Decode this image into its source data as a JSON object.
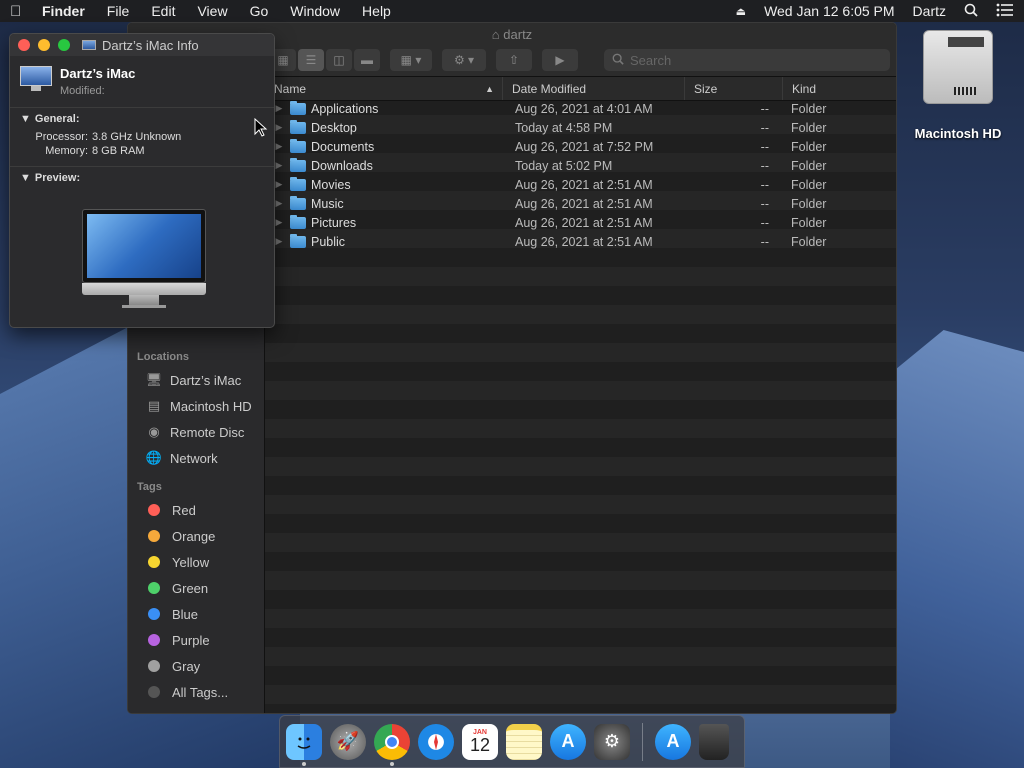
{
  "menubar": {
    "app": "Finder",
    "items": [
      "File",
      "Edit",
      "View",
      "Go",
      "Window",
      "Help"
    ],
    "datetime": "Wed Jan 12  6:05 PM",
    "user": "Dartz"
  },
  "desktop": {
    "drive_label": "Macintosh HD"
  },
  "finder": {
    "title": "dartz",
    "search_placeholder": "Search",
    "sidebar": {
      "locations_header": "Locations",
      "locations": [
        {
          "label": "Dartz’s iMac",
          "icon": "imac-icon"
        },
        {
          "label": "Macintosh HD",
          "icon": "hard-drive-icon"
        },
        {
          "label": "Remote Disc",
          "icon": "disc-icon"
        },
        {
          "label": "Network",
          "icon": "network-icon"
        }
      ],
      "tags_header": "Tags",
      "tags": [
        {
          "label": "Red",
          "color": "#ff5f57"
        },
        {
          "label": "Orange",
          "color": "#f6a93b"
        },
        {
          "label": "Yellow",
          "color": "#f6d530"
        },
        {
          "label": "Green",
          "color": "#4ed06a"
        },
        {
          "label": "Blue",
          "color": "#3a8ff5"
        },
        {
          "label": "Purple",
          "color": "#b763e0"
        },
        {
          "label": "Gray",
          "color": "#a0a0a0"
        },
        {
          "label": "All Tags...",
          "color": "#555555"
        }
      ]
    },
    "columns": {
      "name": "Name",
      "date": "Date Modified",
      "size": "Size",
      "kind": "Kind"
    },
    "rows": [
      {
        "name": "Applications",
        "date": "Aug 26, 2021 at 4:01 AM",
        "size": "--",
        "kind": "Folder"
      },
      {
        "name": "Desktop",
        "date": "Today at 4:58 PM",
        "size": "--",
        "kind": "Folder"
      },
      {
        "name": "Documents",
        "date": "Aug 26, 2021 at 7:52 PM",
        "size": "--",
        "kind": "Folder"
      },
      {
        "name": "Downloads",
        "date": "Today at 5:02 PM",
        "size": "--",
        "kind": "Folder"
      },
      {
        "name": "Movies",
        "date": "Aug 26, 2021 at 2:51 AM",
        "size": "--",
        "kind": "Folder"
      },
      {
        "name": "Music",
        "date": "Aug 26, 2021 at 2:51 AM",
        "size": "--",
        "kind": "Folder"
      },
      {
        "name": "Pictures",
        "date": "Aug 26, 2021 at 2:51 AM",
        "size": "--",
        "kind": "Folder"
      },
      {
        "name": "Public",
        "date": "Aug 26, 2021 at 2:51 AM",
        "size": "--",
        "kind": "Folder"
      }
    ]
  },
  "info_window": {
    "title": "Dartz’s iMac Info",
    "name": "Dartz’s iMac",
    "modified_label": "Modified:",
    "general_header": "General:",
    "processor_label": "Processor:",
    "processor_value": "3.8 GHz Unknown",
    "memory_label": "Memory:",
    "memory_value": "8 GB RAM",
    "preview_header": "Preview:"
  },
  "calendar_icon": {
    "month": "JAN",
    "day": "12"
  },
  "dock": {
    "apps": [
      "finder-icon",
      "launchpad-icon",
      "chrome-icon",
      "safari-icon",
      "calendar-icon",
      "notes-icon",
      "app-store-icon",
      "system-preferences-icon",
      "app-store-icon",
      "trash-icon"
    ]
  }
}
